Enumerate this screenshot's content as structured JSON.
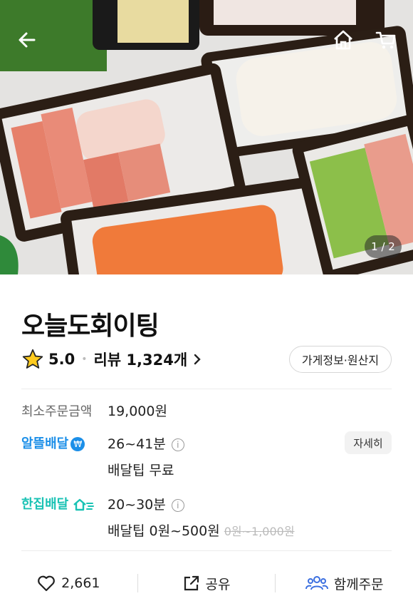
{
  "hero": {
    "image_description_icon": "sashimi-platters-photo",
    "counter": "1 / 2"
  },
  "topbar": {
    "back_icon": "back-arrow-icon",
    "home_icon": "home-icon",
    "cart_icon": "cart-icon"
  },
  "store": {
    "name": "오늘도회이팅",
    "rating": "5.0",
    "reviews": "리뷰 1,324개",
    "info_button": "가게정보·원산지"
  },
  "order": {
    "min_label": "최소주문금액",
    "min_value": "19,000원"
  },
  "delivery_saver": {
    "label": "알뜰배달",
    "badge": "₩",
    "time": "26~41분",
    "tip": "배달팁 무료",
    "detail_button": "자세히"
  },
  "delivery_single": {
    "label": "한집배달",
    "time": "20~30분",
    "tip": "배달팁 0원~500원",
    "tip_original": "0원~1,000원"
  },
  "actions": {
    "likes": "2,661",
    "share": "공유",
    "group_order": "함께주문"
  },
  "colors": {
    "saver_blue": "#1c8fe8",
    "single_teal": "#19c2b4"
  }
}
